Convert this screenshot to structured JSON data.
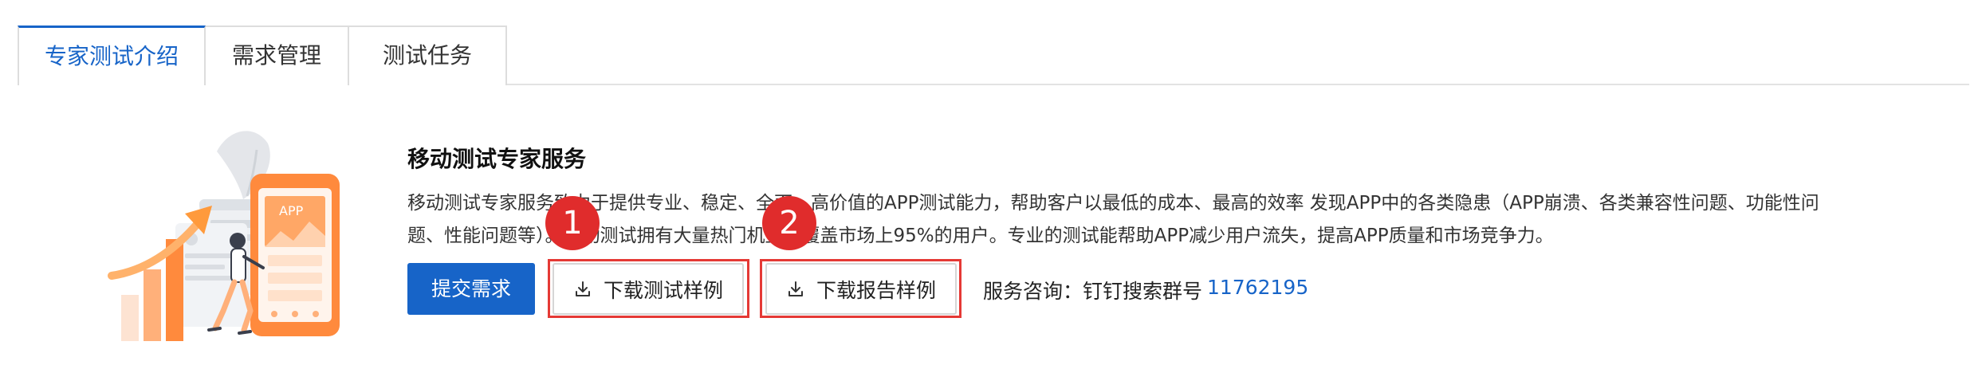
{
  "tabs": [
    {
      "label": "专家测试介绍",
      "active": true
    },
    {
      "label": "需求管理",
      "active": false
    },
    {
      "label": "测试任务",
      "active": false
    }
  ],
  "illustration": {
    "phone_label": "APP"
  },
  "section": {
    "title": "移动测试专家服务",
    "description_line1": "移动测试专家服务致力于提供专业、稳定、全面、高价值的APP测试能力，帮助客户以最低的成本、最高的效率 发现APP中的各类隐患（APP崩溃、各类兼容性问题、功能性问",
    "description_line2": "题、性能问题等）。移动测试拥有大量热门机型，覆盖市场上95%的用户。专业的测试能帮助APP减少用户流失，提高APP质量和市场竞争力。"
  },
  "actions": {
    "submit_label": "提交需求",
    "download_sample_label": "下载测试样例",
    "download_report_label": "下载报告样例",
    "download_icon": "download-icon"
  },
  "markers": [
    "1",
    "2"
  ],
  "consult": {
    "label": "服务咨询：钉钉搜索群号",
    "number": "11762195"
  },
  "colors": {
    "primary": "#1764c8",
    "marker": "#e02c2c",
    "illustration_orange": "#ff8a3d"
  }
}
